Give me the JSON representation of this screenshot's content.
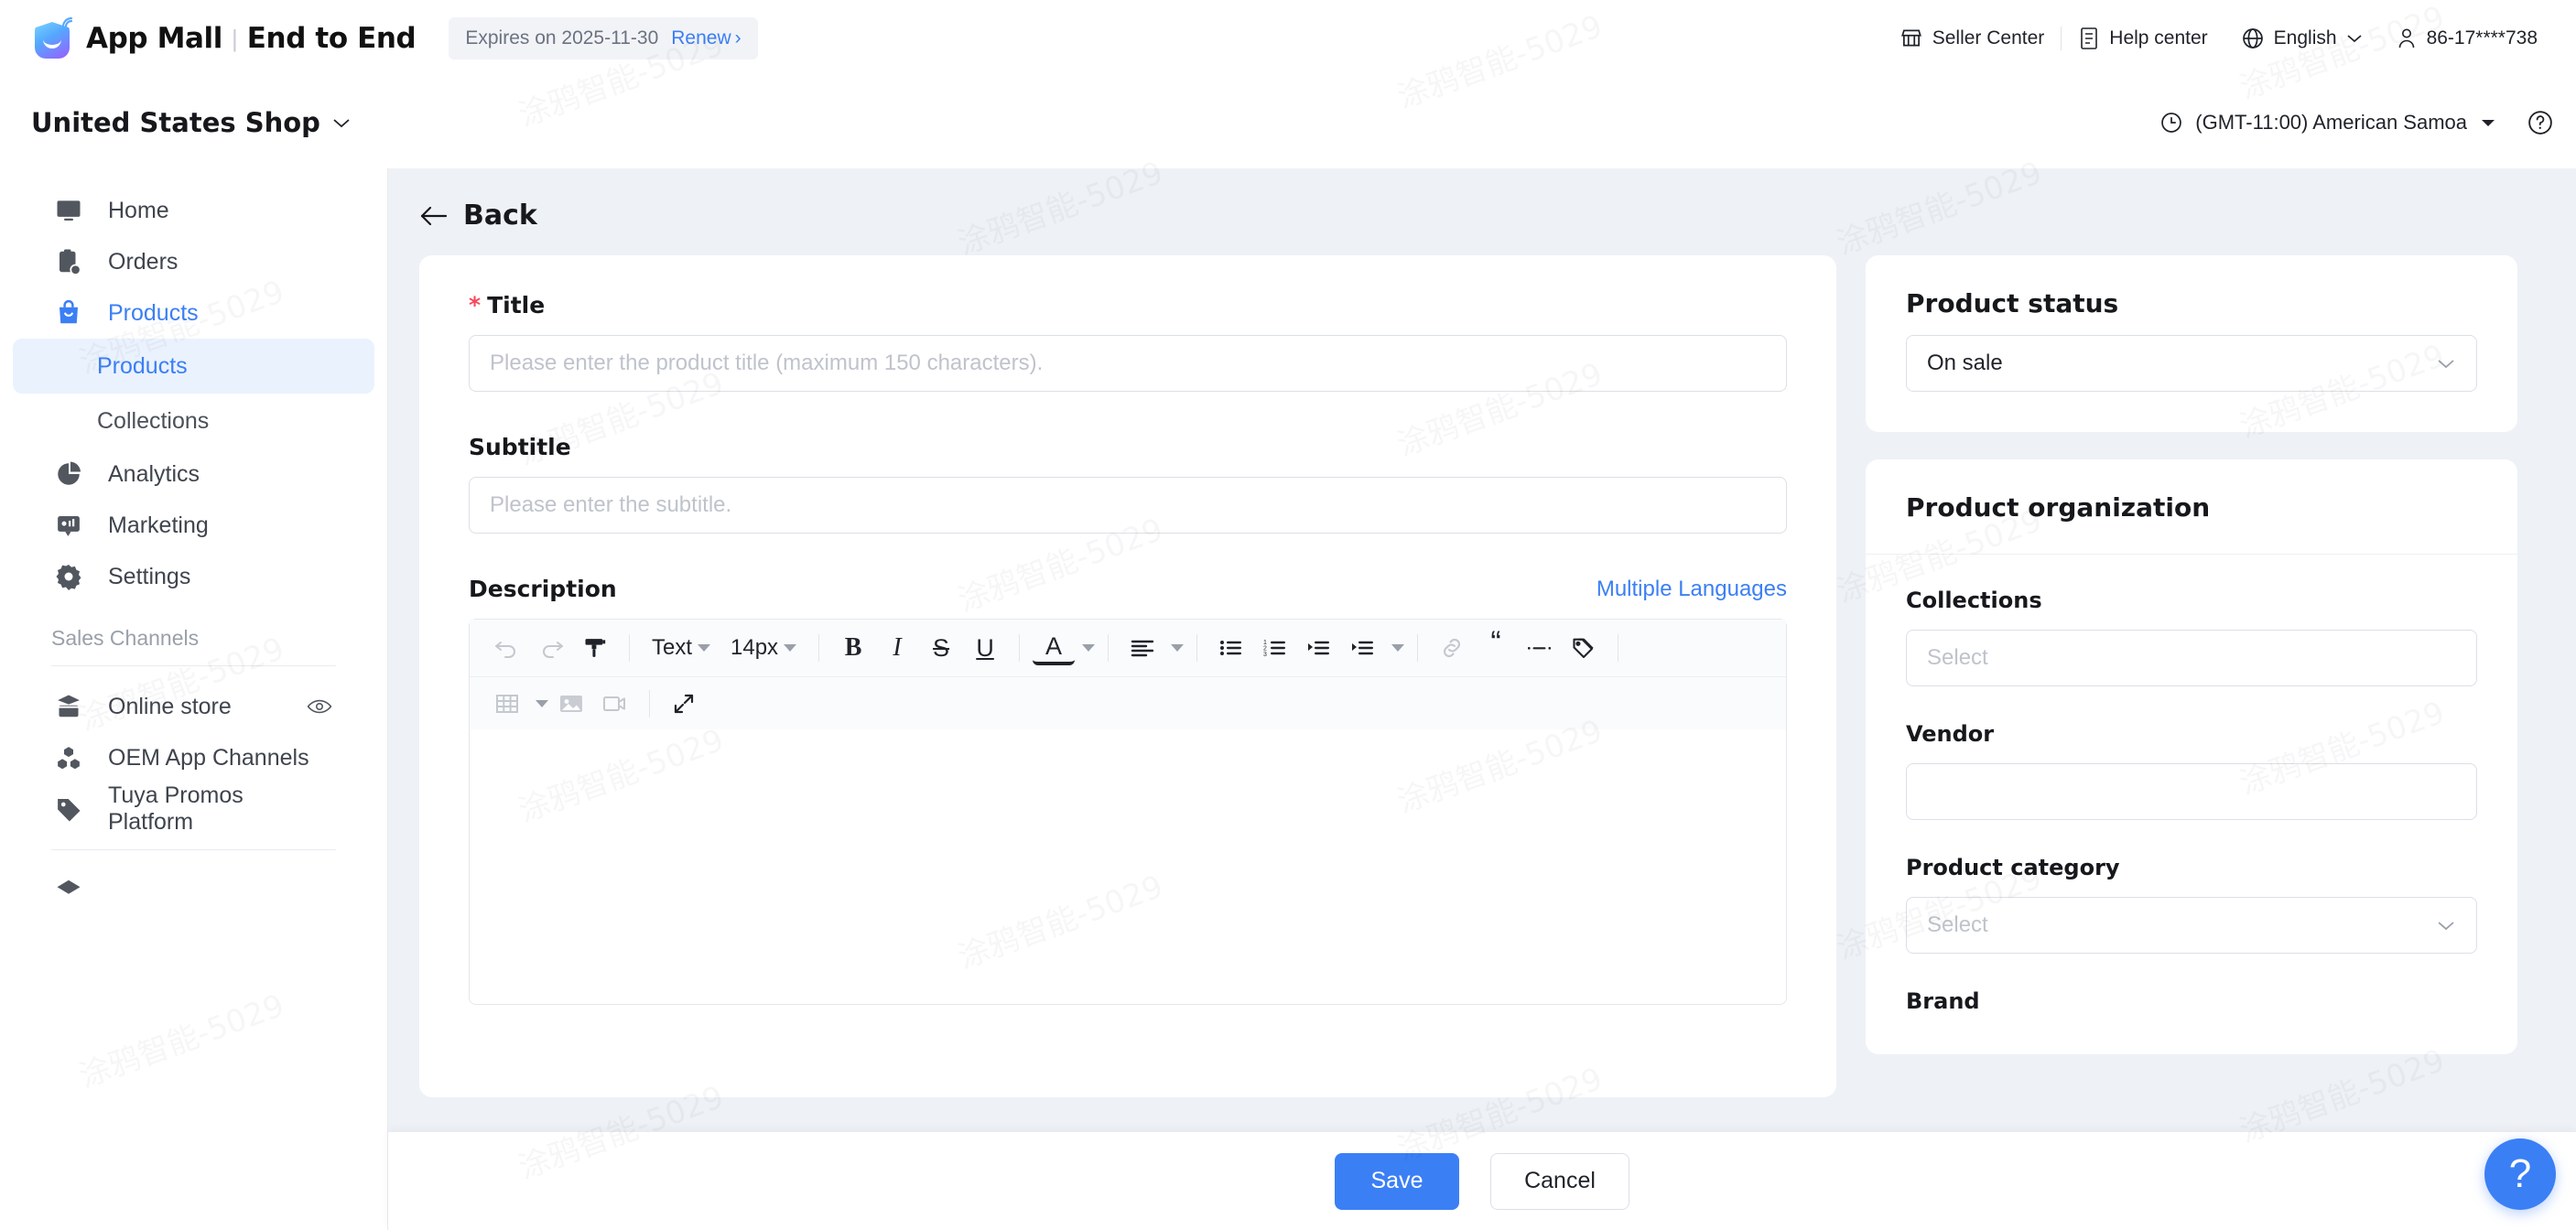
{
  "header": {
    "brand": "App Mall",
    "brand_separator": "|",
    "brand_sub": "End to End",
    "expiry_text": "Expires on 2025-11-30",
    "renew_label": "Renew",
    "renew_chevron": "›",
    "seller_center": "Seller Center",
    "help_center": "Help center",
    "language": "English",
    "account": "86-17****738",
    "icons": {
      "store": "store-icon",
      "doc": "document-icon",
      "globe": "globe-icon",
      "user": "user-icon"
    }
  },
  "subheader": {
    "shop_name": "United States Shop",
    "timezone": "(GMT-11:00) American Samoa",
    "help_glyph": "?"
  },
  "sidebar": {
    "items": [
      {
        "label": "Home",
        "icon": "monitor-chart-icon",
        "active": false
      },
      {
        "label": "Orders",
        "icon": "clipboard-check-icon",
        "active": false
      },
      {
        "label": "Products",
        "icon": "shopping-bag-icon",
        "active": true
      }
    ],
    "sub_items": [
      {
        "label": "Products",
        "selected": true
      },
      {
        "label": "Collections",
        "selected": false
      }
    ],
    "items2": [
      {
        "label": "Analytics",
        "icon": "pie-chart-icon"
      },
      {
        "label": "Marketing",
        "icon": "megaphone-icon"
      },
      {
        "label": "Settings",
        "icon": "gear-icon"
      }
    ],
    "section_label": "Sales Channels",
    "channels": [
      {
        "label": "Online store",
        "icon": "storefront-icon",
        "trailing": "eye-icon"
      },
      {
        "label": "OEM App Channels",
        "icon": "cubes-icon",
        "trailing": ""
      },
      {
        "label": "Tuya Promos Platform",
        "icon": "tag-icon",
        "trailing": ""
      }
    ]
  },
  "main": {
    "back_label": "Back",
    "title_label": "Title",
    "title_required": "*",
    "title_placeholder": "Please enter the product title (maximum 150 characters).",
    "title_value": "",
    "subtitle_label": "Subtitle",
    "subtitle_placeholder": "Please enter the subtitle.",
    "subtitle_value": "",
    "description_label": "Description",
    "multiple_languages": "Multiple Languages",
    "editor": {
      "font_style": "Text",
      "font_size": "14px",
      "bold": "B",
      "italic": "I",
      "strike": "S",
      "underline": "U",
      "font_color": "A",
      "quote": "“",
      "tools_row1": [
        "undo-icon",
        "redo-icon",
        "format-painter-icon",
        "text-style-dropdown",
        "font-size-dropdown",
        "bold-icon",
        "italic-icon",
        "strikethrough-icon",
        "underline-icon",
        "font-color-icon",
        "align-icon",
        "bullet-list-icon",
        "numbered-list-icon",
        "indent-icon",
        "link-icon",
        "blockquote-icon",
        "horizontal-rule-icon",
        "tag-icon"
      ],
      "tools_row2": [
        "table-icon",
        "image-icon",
        "video-icon",
        "fullscreen-icon"
      ],
      "content": ""
    }
  },
  "right": {
    "status_card": {
      "title": "Product status",
      "value": "On sale"
    },
    "organization_card": {
      "title": "Product organization",
      "fields": [
        {
          "label": "Collections",
          "placeholder": "Select",
          "type": "select-search",
          "value": ""
        },
        {
          "label": "Vendor",
          "placeholder": "",
          "type": "input",
          "value": ""
        },
        {
          "label": "Product category",
          "placeholder": "Select",
          "type": "select",
          "value": ""
        },
        {
          "label": "Brand",
          "placeholder": "",
          "type": "label-only",
          "value": ""
        }
      ]
    }
  },
  "footer": {
    "save_label": "Save",
    "cancel_label": "Cancel"
  },
  "fab": {
    "glyph": "?"
  },
  "watermark_text": "涂鸦智能-5029",
  "colors": {
    "accent": "#3b7ff5",
    "required": "#f5485c",
    "page_bg": "#eef1f6",
    "card_bg": "#ffffff",
    "text": "#1f2329",
    "muted": "#9aa0a9",
    "placeholder": "#bfc3cb"
  }
}
